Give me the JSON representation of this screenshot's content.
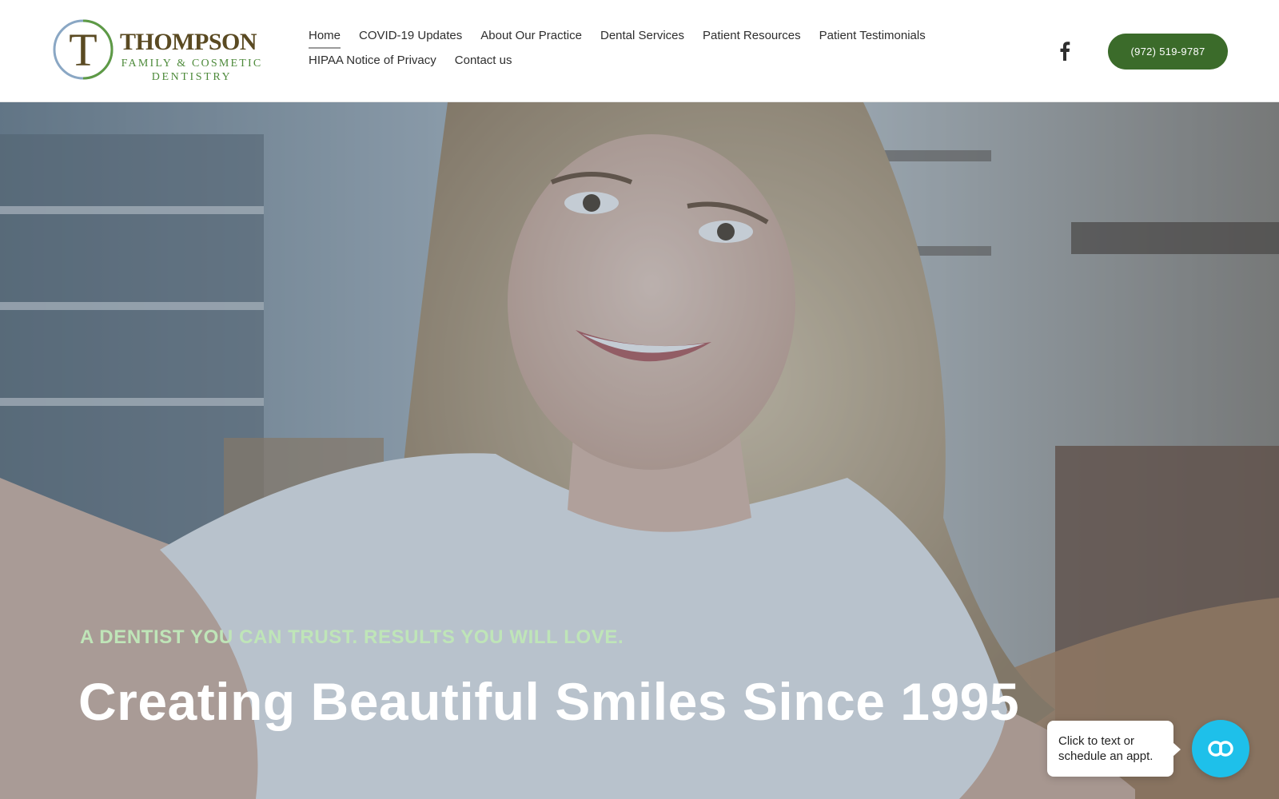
{
  "brand": {
    "logo_letter": "T",
    "name": "THOMPSON",
    "subtitle_line1": "FAMILY & COSMETIC",
    "subtitle_line2": "DENTISTRY",
    "primary_color": "#3b6b2a",
    "accent_color": "#4d8a3a"
  },
  "nav": {
    "row1": [
      {
        "label": "Home",
        "active": true
      },
      {
        "label": "COVID-19 Updates"
      },
      {
        "label": "About Our Practice"
      },
      {
        "label": "Dental Services"
      },
      {
        "label": "Patient Resources"
      },
      {
        "label": "Patient Testimonials"
      }
    ],
    "row2": [
      {
        "label": "HIPAA Notice of Privacy"
      },
      {
        "label": "Contact us"
      }
    ]
  },
  "social": {
    "icon": "facebook-icon"
  },
  "phone_button": {
    "label": "(972) 519-9787"
  },
  "hero": {
    "tagline": "A DENTIST YOU CAN TRUST. RESULTS YOU WILL LOVE.",
    "headline": "Creating Beautiful Smiles Since 1995"
  },
  "chat": {
    "line1": "Click to text or",
    "line2": "schedule an appt.",
    "icon": "chat-loop-icon",
    "color": "#1ec0ea"
  }
}
